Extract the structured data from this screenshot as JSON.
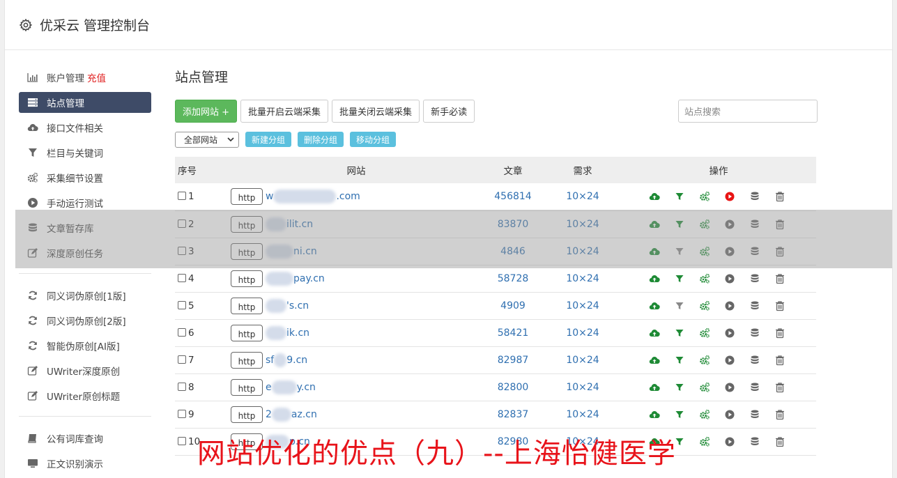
{
  "app": {
    "title": "优采云 管理控制台"
  },
  "sidebar": {
    "items": [
      {
        "label": "账户管理",
        "extra": "充值",
        "icon": "bar-chart-icon"
      },
      {
        "label": "站点管理",
        "icon": "server-list-icon",
        "active": true
      },
      {
        "label": "接口文件相关",
        "icon": "cloud-upload-icon"
      },
      {
        "label": "栏目与关键词",
        "icon": "filter-icon"
      },
      {
        "label": "采集细节设置",
        "icon": "cogs-icon"
      },
      {
        "label": "手动运行测试",
        "icon": "play-circle-icon"
      },
      {
        "label": "文章暂存库",
        "icon": "database-icon"
      },
      {
        "label": "深度原创任务",
        "icon": "edit-icon"
      }
    ],
    "items2": [
      {
        "label": "同义词伪原创[1版]",
        "icon": "refresh-icon"
      },
      {
        "label": "同义词伪原创[2版]",
        "icon": "refresh-icon"
      },
      {
        "label": "智能伪原创[AI版]",
        "icon": "refresh-icon"
      },
      {
        "label": "UWriter深度原创",
        "icon": "edit-icon"
      },
      {
        "label": "UWriter原创标题",
        "icon": "edit-icon"
      }
    ],
    "items3": [
      {
        "label": "公有词库查询",
        "icon": "book-icon"
      },
      {
        "label": "正文识别演示",
        "icon": "monitor-icon"
      }
    ]
  },
  "main": {
    "title": "站点管理",
    "buttons": {
      "add": "添加网站 +",
      "batch_on": "批量开启云端采集",
      "batch_off": "批量关闭云端采集",
      "guide": "新手必读"
    },
    "search_placeholder": "站点搜索",
    "group_select": "全部网站",
    "group_buttons": {
      "new": "新建分组",
      "delete": "删除分组",
      "move": "移动分组"
    },
    "table": {
      "headers": {
        "no": "序号",
        "site": "网站",
        "articles": "文章",
        "demand": "需求",
        "ops": "操作"
      },
      "rows": [
        {
          "no": "1",
          "prefix": "http",
          "domain": "w",
          "domain_end": ".com",
          "articles": "456814",
          "demand": "10×24",
          "active": true
        },
        {
          "no": "2",
          "prefix": "http",
          "domain": "",
          "domain_end": "ilit.cn",
          "articles": "83870",
          "demand": "10×24",
          "active": false
        },
        {
          "no": "3",
          "prefix": "http",
          "domain": "",
          "domain_end": "ni.cn",
          "articles": "4846",
          "demand": "10×24",
          "active": false
        },
        {
          "no": "4",
          "prefix": "http",
          "domain": "",
          "domain_end": "pay.cn",
          "articles": "58728",
          "demand": "10×24",
          "active": false
        },
        {
          "no": "5",
          "prefix": "http",
          "domain": "",
          "domain_end": "'s.cn",
          "articles": "4909",
          "demand": "10×24",
          "active": false
        },
        {
          "no": "6",
          "prefix": "http",
          "domain": "",
          "domain_end": "ik.cn",
          "articles": "58421",
          "demand": "10×24",
          "active": false
        },
        {
          "no": "7",
          "prefix": "http",
          "domain": "sf",
          "domain_end": "9.cn",
          "articles": "82987",
          "demand": "10×24",
          "active": false
        },
        {
          "no": "8",
          "prefix": "http",
          "domain": "e",
          "domain_end": "y.cn",
          "articles": "82800",
          "demand": "10×24",
          "active": false
        },
        {
          "no": "9",
          "prefix": "http",
          "domain": "2",
          "domain_end": "az.cn",
          "articles": "82837",
          "demand": "10×24",
          "active": false
        },
        {
          "no": "10",
          "prefix": "http",
          "domain": "",
          "domain_end": "p.cn",
          "articles": "82980",
          "demand": "10×24",
          "active": false
        }
      ]
    }
  },
  "watermark": "网站优化的优点（九）--上海怡健医学",
  "colors": {
    "nav_active": "#3e4b67",
    "green": "#5cb85c",
    "info": "#5bc0de",
    "link": "#2f6fb0",
    "icon_green": "#1e8a35",
    "play_active": "#e81414"
  }
}
